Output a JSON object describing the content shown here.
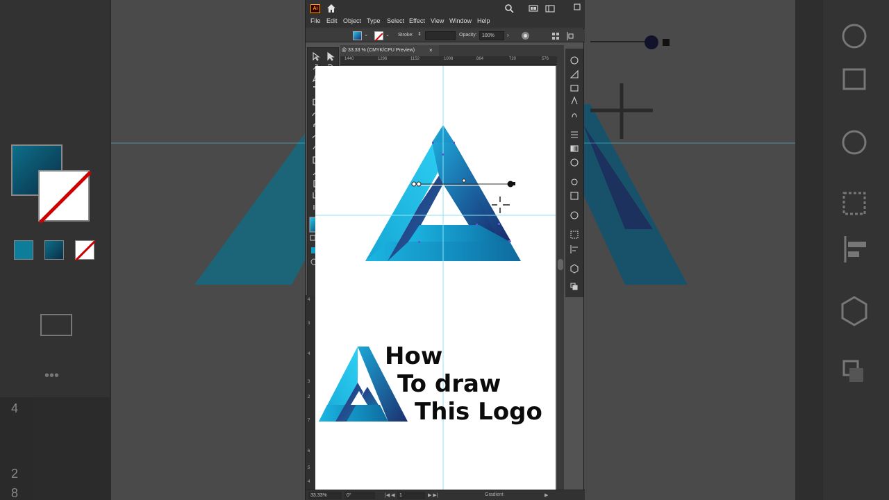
{
  "app": {
    "logo": "Ai",
    "menu": [
      "File",
      "Edit",
      "Object",
      "Type",
      "Select",
      "Effect",
      "View",
      "Window",
      "Help"
    ]
  },
  "control_bar": {
    "stroke_label": "Stroke:",
    "opacity_label": "Opacity:",
    "opacity_value": "100%"
  },
  "document": {
    "tab_title": "@ 33.33 % (CMYK/CPU Preview)",
    "close_glyph": "×",
    "ruler_h": [
      "1440",
      "1296",
      "1152",
      "1008",
      "864",
      "720",
      "576"
    ],
    "ruler_v": [
      "4",
      "3",
      "4",
      "3",
      "2",
      "7",
      "6",
      "5",
      "4"
    ]
  },
  "overlay_text": {
    "line1": "How",
    "line2": "To draw",
    "line3": "This Logo"
  },
  "statusbar": {
    "zoom": "33.33%",
    "rotation": "0°",
    "artboard": "1",
    "tool_name": "Gradient"
  },
  "background_ruler": [
    "4",
    "2",
    "8"
  ],
  "colors": {
    "gradient_light": "#22c4ee",
    "gradient_mid": "#0f8fbf",
    "gradient_dark": "#1a2d6e",
    "guide": "#7fe0f0",
    "ui_dark": "#323232"
  }
}
